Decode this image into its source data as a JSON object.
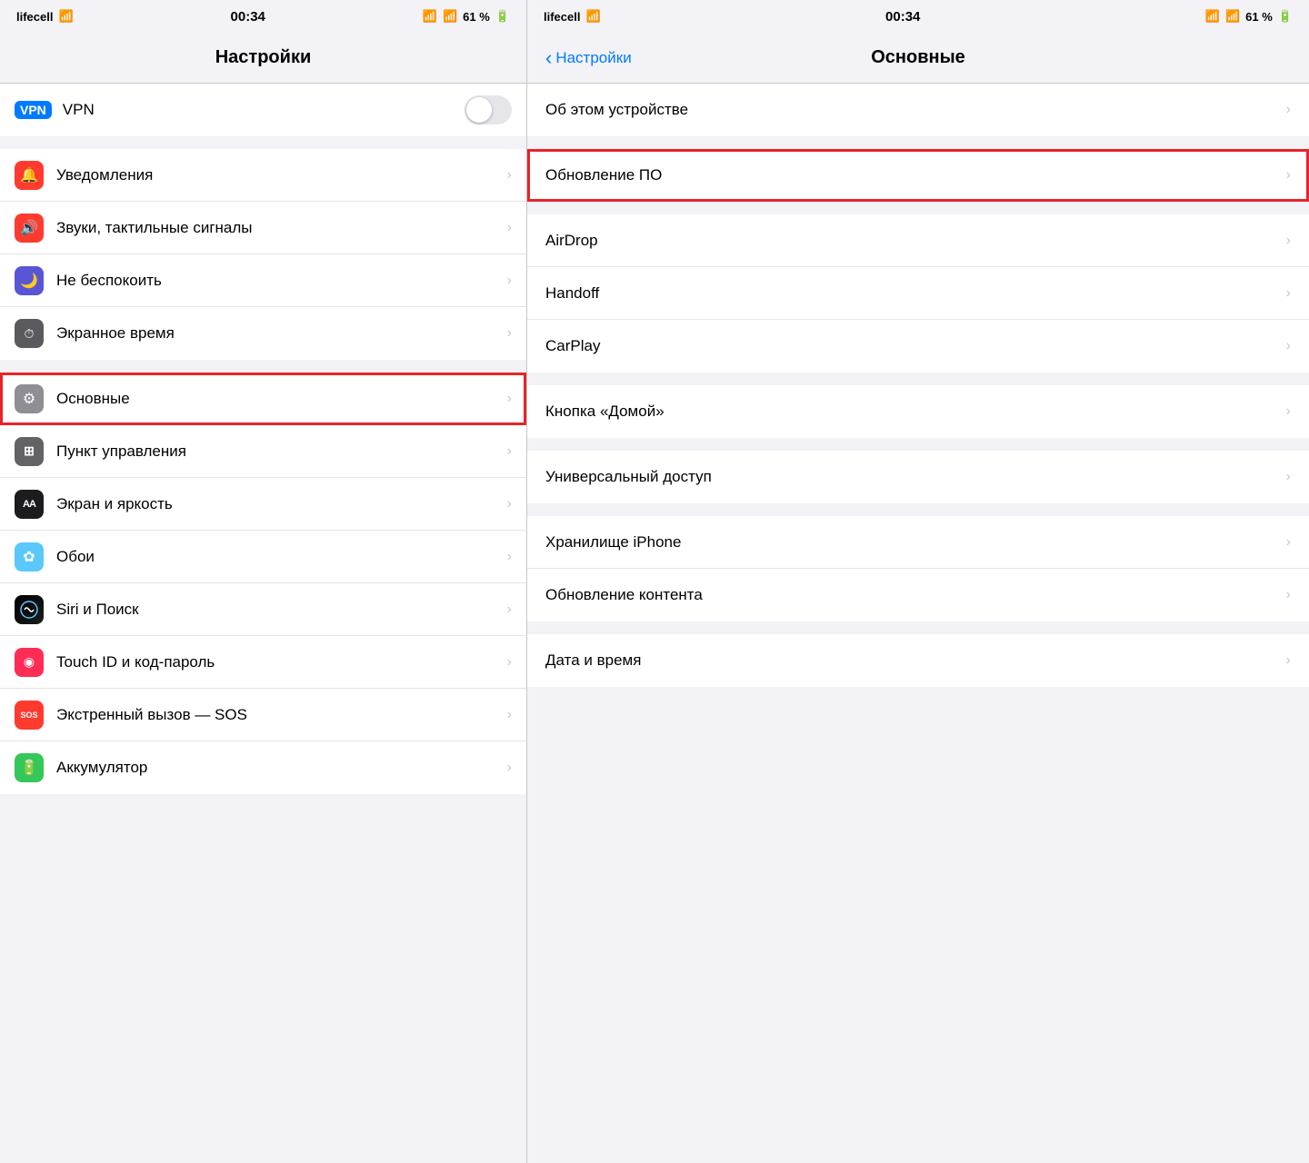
{
  "left": {
    "status_bar": {
      "carrier": "lifecell",
      "wifi": "WiFi",
      "time": "00:34",
      "battery": "61 %"
    },
    "nav_title": "Настройки",
    "items": [
      {
        "id": "vpn",
        "label": "VPN",
        "icon_type": "vpn",
        "has_toggle": true,
        "has_chevron": false,
        "highlighted": false
      }
    ],
    "groups": [
      {
        "items": [
          {
            "id": "notifications",
            "label": "Уведомления",
            "icon": "🔔",
            "icon_color": "icon-red",
            "has_chevron": true,
            "highlighted": false
          },
          {
            "id": "sounds",
            "label": "Звуки, тактильные сигналы",
            "icon": "🔊",
            "icon_color": "icon-red2",
            "has_chevron": true,
            "highlighted": false
          },
          {
            "id": "donotdisturb",
            "label": "Не беспокоить",
            "icon": "🌙",
            "icon_color": "icon-purple",
            "has_chevron": true,
            "highlighted": false
          },
          {
            "id": "screentime",
            "label": "Экранное время",
            "icon": "⏱",
            "icon_color": "icon-gray",
            "has_chevron": true,
            "highlighted": false
          }
        ]
      },
      {
        "items": [
          {
            "id": "general",
            "label": "Основные",
            "icon": "⚙️",
            "icon_color": "icon-gray",
            "has_chevron": true,
            "highlighted": true
          },
          {
            "id": "controlcenter",
            "label": "Пункт управления",
            "icon": "⊞",
            "icon_color": "icon-gray",
            "has_chevron": true,
            "highlighted": false
          },
          {
            "id": "display",
            "label": "Экран и яркость",
            "icon": "AA",
            "icon_color": "icon-blue",
            "has_chevron": true,
            "highlighted": false
          },
          {
            "id": "wallpaper",
            "label": "Обои",
            "icon": "✿",
            "icon_color": "icon-teal",
            "has_chevron": true,
            "highlighted": false
          },
          {
            "id": "siri",
            "label": "Siri и Поиск",
            "icon": "◎",
            "icon_color": "icon-siri",
            "has_chevron": true,
            "highlighted": false
          },
          {
            "id": "touchid",
            "label": "Touch ID и код-пароль",
            "icon": "◉",
            "icon_color": "icon-pink",
            "has_chevron": true,
            "highlighted": false
          },
          {
            "id": "sos",
            "label": "Экстренный вызов — SOS",
            "icon": "SOS",
            "icon_color": "icon-red",
            "has_chevron": true,
            "highlighted": false
          },
          {
            "id": "battery",
            "label": "Аккумулятор",
            "icon": "🔋",
            "icon_color": "icon-green",
            "has_chevron": true,
            "highlighted": false
          }
        ]
      }
    ]
  },
  "right": {
    "status_bar": {
      "carrier": "lifecell",
      "wifi": "WiFi",
      "time": "00:34",
      "battery": "61 %"
    },
    "nav_back_label": "Настройки",
    "nav_title": "Основные",
    "groups": [
      {
        "items": [
          {
            "id": "about",
            "label": "Об этом устройстве",
            "has_chevron": true,
            "highlighted": false
          }
        ]
      },
      {
        "items": [
          {
            "id": "software_update",
            "label": "Обновление ПО",
            "has_chevron": true,
            "highlighted": true
          }
        ]
      },
      {
        "items": [
          {
            "id": "airdrop",
            "label": "AirDrop",
            "has_chevron": true,
            "highlighted": false
          },
          {
            "id": "handoff",
            "label": "Handoff",
            "has_chevron": true,
            "highlighted": false
          },
          {
            "id": "carplay",
            "label": "CarPlay",
            "has_chevron": true,
            "highlighted": false
          }
        ]
      },
      {
        "items": [
          {
            "id": "homebutton",
            "label": "Кнопка «Домой»",
            "has_chevron": true,
            "highlighted": false
          }
        ]
      },
      {
        "items": [
          {
            "id": "accessibility",
            "label": "Универсальный доступ",
            "has_chevron": true,
            "highlighted": false
          }
        ]
      },
      {
        "items": [
          {
            "id": "storage",
            "label": "Хранилище iPhone",
            "has_chevron": true,
            "highlighted": false
          },
          {
            "id": "background_refresh",
            "label": "Обновление контента",
            "has_chevron": true,
            "highlighted": false
          }
        ]
      },
      {
        "items": [
          {
            "id": "datetime",
            "label": "Дата и время",
            "has_chevron": true,
            "highlighted": false
          }
        ]
      }
    ]
  },
  "icons": {
    "chevron": "›",
    "back_chevron": "‹"
  }
}
